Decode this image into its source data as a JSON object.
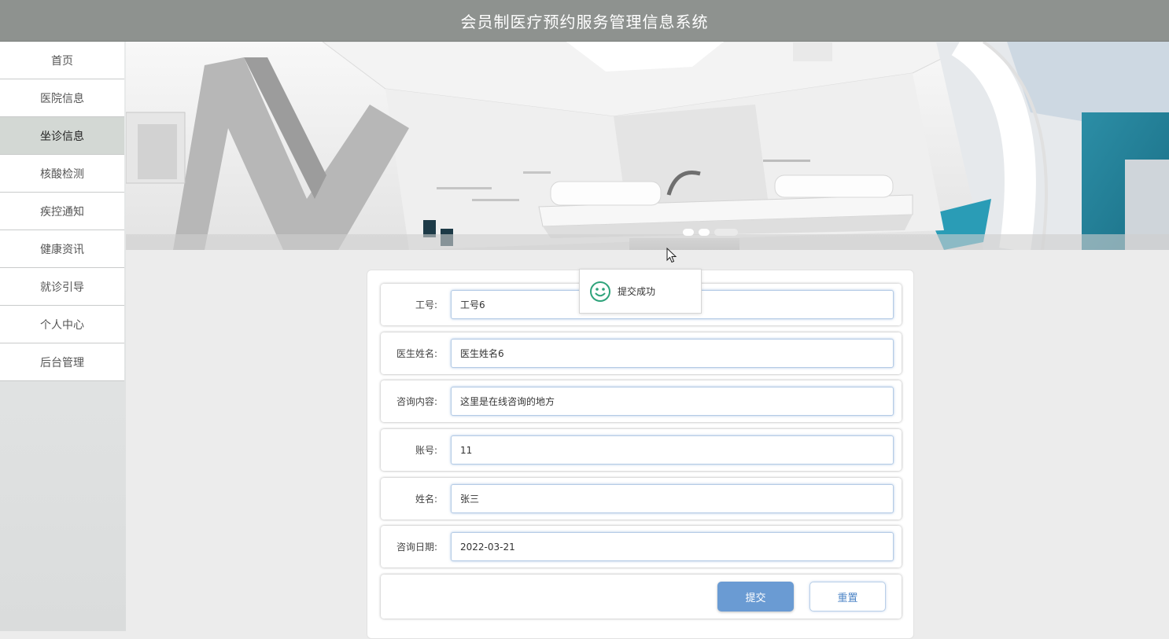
{
  "header": {
    "title": "会员制医疗预约服务管理信息系统"
  },
  "sidebar": {
    "items": [
      {
        "label": "首页"
      },
      {
        "label": "医院信息"
      },
      {
        "label": "坐诊信息",
        "active": true
      },
      {
        "label": "核酸检测"
      },
      {
        "label": "疾控通知"
      },
      {
        "label": "健康资讯"
      },
      {
        "label": "就诊引导"
      },
      {
        "label": "个人中心"
      },
      {
        "label": "后台管理"
      }
    ]
  },
  "banner": {
    "slide_count": 3,
    "active_slide": 3
  },
  "toast": {
    "icon": "smile-icon",
    "message": "提交成功",
    "color": "#2fa37b"
  },
  "form": {
    "fields": [
      {
        "label": "工号:",
        "value": "工号6"
      },
      {
        "label": "医生姓名:",
        "value": "医生姓名6"
      },
      {
        "label": "咨询内容:",
        "value": "这里是在线咨询的地方"
      },
      {
        "label": "账号:",
        "value": "11"
      },
      {
        "label": "姓名:",
        "value": "张三"
      },
      {
        "label": "咨询日期:",
        "value": "2022-03-21"
      }
    ],
    "submit_label": "提交",
    "reset_label": "重置"
  },
  "colors": {
    "header_bg": "#8e928f",
    "nav_active_bg": "#d3d8d4",
    "submit_bg": "#6a9bd3",
    "reset_text": "#4f86c6"
  }
}
